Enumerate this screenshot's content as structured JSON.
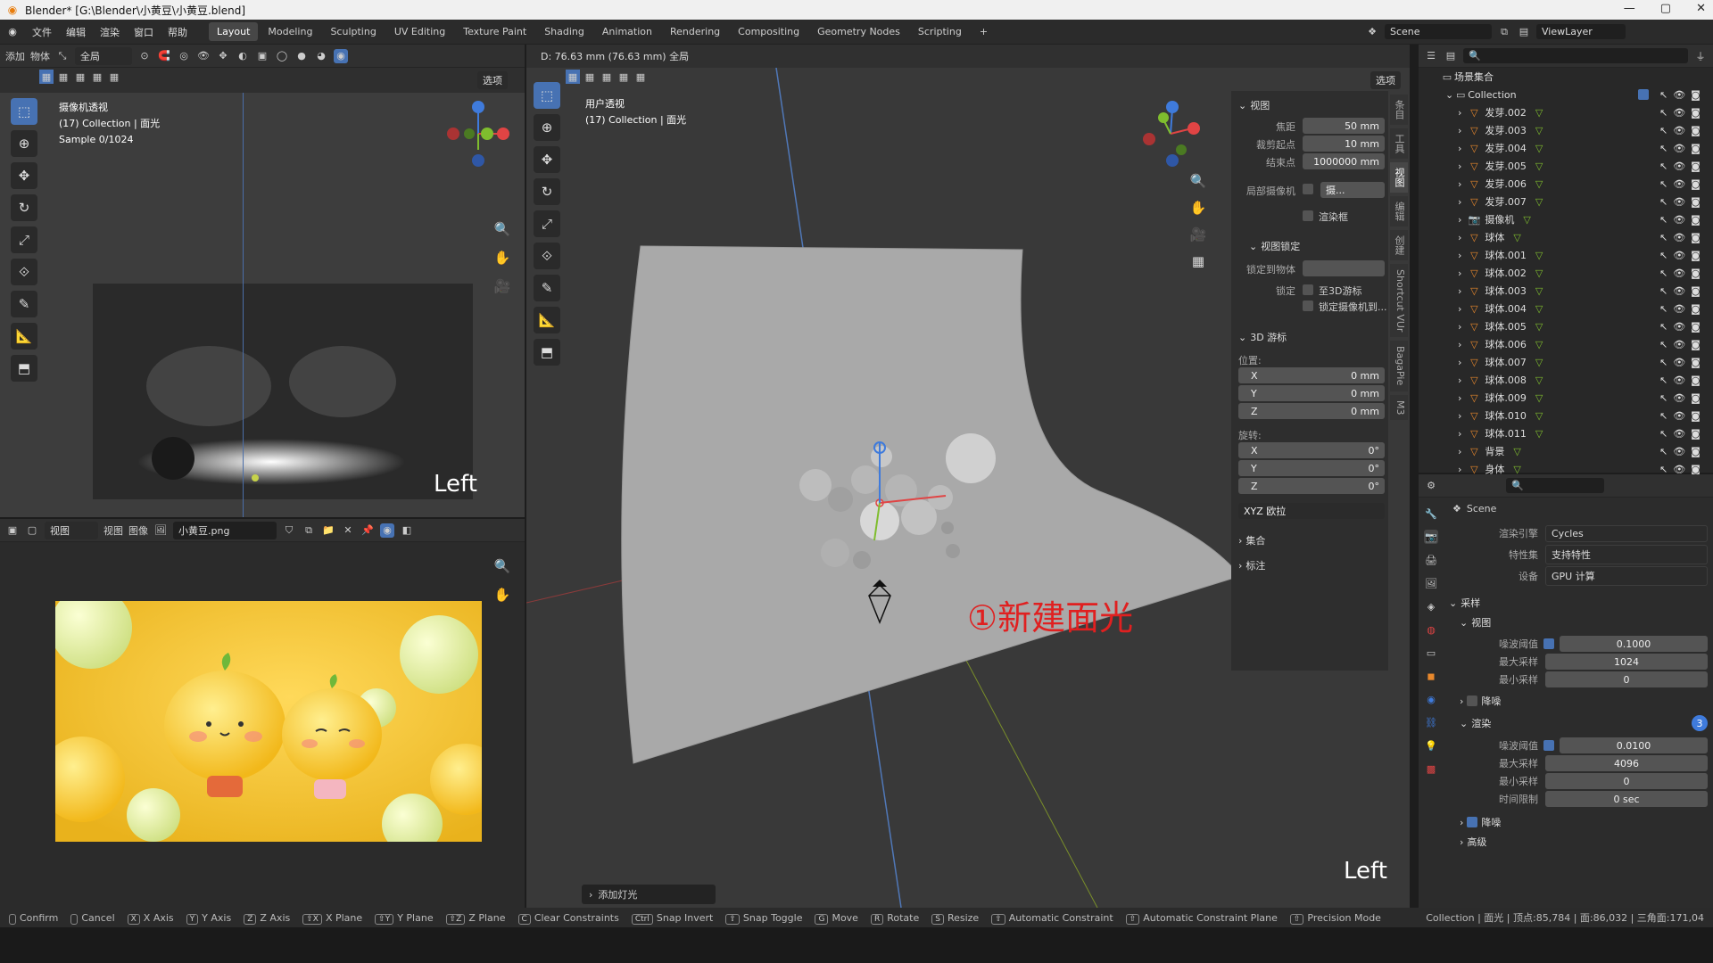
{
  "title": "Blender* [G:\\Blender\\小黄豆\\小黄豆.blend]",
  "window_controls": [
    "—",
    "▢",
    "✕"
  ],
  "menu": [
    "文件",
    "编辑",
    "渲染",
    "窗口",
    "帮助"
  ],
  "workspaces": [
    "Layout",
    "Modeling",
    "Sculpting",
    "UV Editing",
    "Texture Paint",
    "Shading",
    "Animation",
    "Rendering",
    "Compositing",
    "Geometry Nodes",
    "Scripting",
    "+"
  ],
  "scene": "Scene",
  "viewlayer": "ViewLayer",
  "left_header": {
    "menus": [
      "添加",
      "物体"
    ],
    "mode": "全局",
    "options": "选项"
  },
  "cam_view": {
    "line1": "摄像机透视",
    "line2": "(17) Collection | 面光",
    "line3": "Sample 0/1024",
    "corner": "Left"
  },
  "image_editor": {
    "view": "视图",
    "menus": [
      "视图",
      "图像"
    ],
    "filename": "小黄豆.png"
  },
  "main_vp": {
    "measure": "D: 76.63 mm (76.63 mm) 全局",
    "options": "选项",
    "line1": "用户透视",
    "line2": "(17) Collection | 面光",
    "annotation": "①新建面光",
    "corner": "Left",
    "add_light": "添加灯光"
  },
  "npanel": {
    "view_title": "视图",
    "focal_label": "焦距",
    "focal": "50 mm",
    "clip_start_label": "裁剪起点",
    "clip_start": "10 mm",
    "clip_end_label": "结束点",
    "clip_end": "1000000 mm",
    "local_cam_label": "局部摄像机",
    "local_cam": "摄...",
    "render_region": "渲染框",
    "lock_title": "视图锁定",
    "lock_obj_label": "锁定到物体",
    "lock_label": "锁定",
    "lock_3d": "至3D游标",
    "lock_cam": "锁定摄像机到...",
    "cursor_title": "3D 游标",
    "loc_label": "位置:",
    "x": "X",
    "y": "Y",
    "z": "Z",
    "loc_x": "0 mm",
    "loc_y": "0 mm",
    "loc_z": "0 mm",
    "rot_label": "旋转:",
    "rot_x": "0°",
    "rot_y": "0°",
    "rot_z": "0°",
    "rot_mode": "XYZ 欧拉",
    "collection": "集合",
    "annotation": "标注",
    "tabs": [
      "条目",
      "工具",
      "视图",
      "编辑",
      "创建",
      "Shortcut VUr",
      "BagaPie",
      "M3"
    ]
  },
  "outliner": {
    "root": "场景集合",
    "collection": "Collection",
    "items": [
      "发芽.002",
      "发芽.003",
      "发芽.004",
      "发芽.005",
      "发芽.006",
      "发芽.007",
      "摄像机",
      "球体",
      "球体.001",
      "球体.002",
      "球体.003",
      "球体.004",
      "球体.005",
      "球体.006",
      "球体.007",
      "球体.008",
      "球体.009",
      "球体.010",
      "球体.011",
      "背景",
      "身体"
    ]
  },
  "props": {
    "scene": "Scene",
    "engine_label": "渲染引擎",
    "engine": "Cycles",
    "feature_label": "特性集",
    "feature": "支持特性",
    "device_label": "设备",
    "device": "GPU 计算",
    "sampling": "采样",
    "viewport": "视图",
    "noise_label": "噪波阈值",
    "vp_noise": "0.1000",
    "max_label": "最大采样",
    "vp_max": "1024",
    "min_label": "最小采样",
    "vp_min": "0",
    "denoise": "降噪",
    "render": "渲染",
    "r_noise": "0.0100",
    "r_max": "4096",
    "r_min": "0",
    "time_label": "时间限制",
    "r_time": "0 sec",
    "render_denoise": "降噪",
    "advanced": "高级",
    "badge": "3"
  },
  "status": {
    "items": [
      [
        "",
        "Confirm"
      ],
      [
        "",
        "Cancel"
      ],
      [
        "X",
        "X Axis"
      ],
      [
        "Y",
        "Y Axis"
      ],
      [
        "Z",
        "Z Axis"
      ],
      [
        "⇧X",
        "X Plane"
      ],
      [
        "⇧Y",
        "Y Plane"
      ],
      [
        "⇧Z",
        "Z Plane"
      ],
      [
        "C",
        "Clear Constraints"
      ],
      [
        "Ctrl",
        "Snap Invert"
      ],
      [
        "⇧",
        "Snap Toggle"
      ],
      [
        "G",
        "Move"
      ],
      [
        "R",
        "Rotate"
      ],
      [
        "S",
        "Resize"
      ],
      [
        "⇧",
        "Automatic Constraint"
      ],
      [
        "⇧",
        "Automatic Constraint Plane"
      ],
      [
        "⇧",
        "Precision Mode"
      ]
    ],
    "right": "Collection | 面光 | 顶点:85,784 | 面:86,032 | 三角面:171,04"
  },
  "colors": {
    "accent": "#4772b3",
    "x_axis": "#e04444",
    "y_axis": "#7fbd2e",
    "z_axis": "#3f7bdc",
    "orange": "#e8882c"
  }
}
